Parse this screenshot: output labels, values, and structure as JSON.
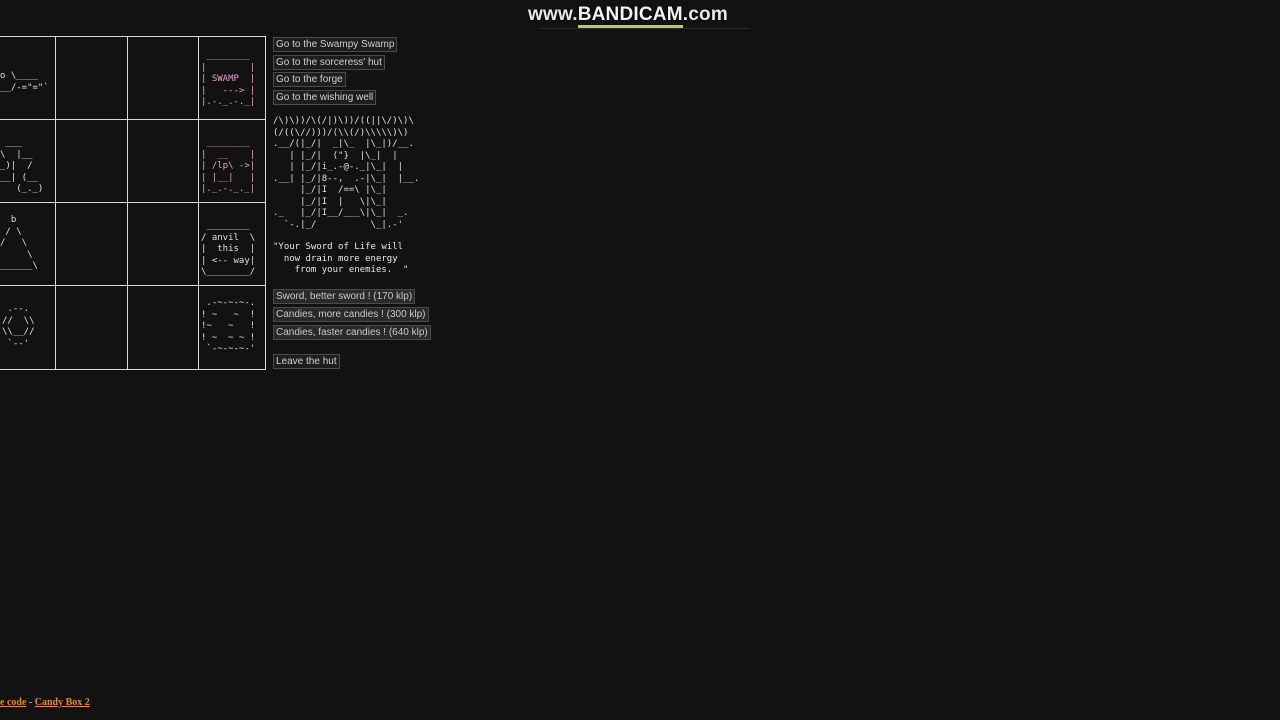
{
  "watermark": {
    "prefix": "www.",
    "mid": "BANDICAM",
    "suffix": ".com"
  },
  "map": {
    "cells": {
      "r0c0": "o \\____\n__/-=\"=\"`",
      "r0c3": " ________\n|        |\n| SWAMP  |\n|   ---> |\n|.-._.-._|",
      "r1c0": " ___\n\\  |__\n_)|  /\n__| (__\n   (_._)",
      "r1c3": " ________\n|  __    |\n| /lp\\ ->|\n| |__|   |\n|._.-._._|",
      "r2c0": "  b\n / \\\n/   \\\n     \\\n______\\",
      "r2c3": " ________\n/ anvil  \\\n|  this  |\n| <-- way|\n\\________/",
      "r3c0": " .--.\n//  \\\\\n\\\\__//\n `--'",
      "r3c3": " .-~-~-~-.\n! ~   ~  !\n!~   ~   !\n! ~  ~ ~ !\n `-~-~-~-'"
    }
  },
  "nav": {
    "swamp": "Go to the Swampy Swamp",
    "hut": "Go to the sorceress' hut",
    "forge": "Go to the forge",
    "well": "Go to the wishing well"
  },
  "hut_art": "/\\)\\))/\\(/|)\\))/((||\\/)\\)\\\n(/((\\//)))/(\\\\(/)\\\\\\\\\\)\\)\n.__/(|_/|  _|\\_  |\\_|)/__.\n   | |_/|  (\"}  |\\_|  |\n   | |_/|i_.-@-._|\\_|  |\n.__| |_/|8--,  .-|\\_|  |__.\n     |_/|I  /==\\ |\\_|\n     |_/|I  |   \\|\\_|\n._   |_/|I__/___\\|\\_|  _.\n  `-.|_/          \\_|.-'",
  "quote": "\"Your Sword of Life will\n  now drain more energy\n    from your enemies.  \"",
  "shop": {
    "sword": "Sword, better sword ! (170 klp)",
    "more_candies": "Candies, more candies ! (300 klp)",
    "faster_candies": "Candies, faster candies ! (640 klp)"
  },
  "leave": "Leave the hut",
  "footer": {
    "source": "e code",
    "separator": " - ",
    "game": "Candy Box 2"
  }
}
